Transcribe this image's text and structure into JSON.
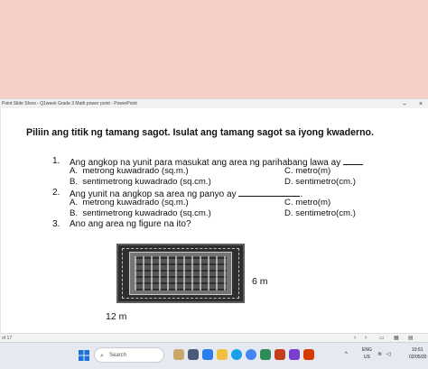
{
  "window": {
    "title": "Point Slide Show - Q1week Grade 3 Math power point - PowerPoint"
  },
  "slide": {
    "heading": "Piliin ang titik ng tamang sagot. Isulat ang tamang sagot sa iyong kwaderno.",
    "questions": [
      {
        "number": "1.",
        "text": "Ang angkop na yunit para masukat ang area ng parihabang lawa ay",
        "choices": [
          {
            "letter": "A.",
            "text": "metrong kuwadrado (sq.m.)"
          },
          {
            "letter": "C.",
            "text": "metro(m)"
          },
          {
            "letter": "B.",
            "text": "sentimetrong kuwadrado (sq.cm.)"
          },
          {
            "letter": "D.",
            "text": "sentimetro(cm.)"
          }
        ]
      },
      {
        "number": "2.",
        "text": "Ang yunit na angkop sa area ng panyo ay",
        "suffix": ".",
        "choices": [
          {
            "letter": "A.",
            "text": "metrong kuwadrado (sq.m.)"
          },
          {
            "letter": "C.",
            "text": "metro(m)"
          },
          {
            "letter": "B.",
            "text": "sentimetrong kuwadrado (sq.cm.)"
          },
          {
            "letter": "D.",
            "text": "sentimetro(cm.)"
          }
        ]
      },
      {
        "number": "3.",
        "text": "Ano ang area ng figure na ito?"
      }
    ],
    "figure": {
      "width_label": "12 m",
      "height_label": "6 m"
    }
  },
  "statusbar": {
    "slide_info": "of 17"
  },
  "taskbar": {
    "search_placeholder": "Search",
    "language": "ENG",
    "region": "US",
    "time": "10:51",
    "date": "02/05/20"
  }
}
